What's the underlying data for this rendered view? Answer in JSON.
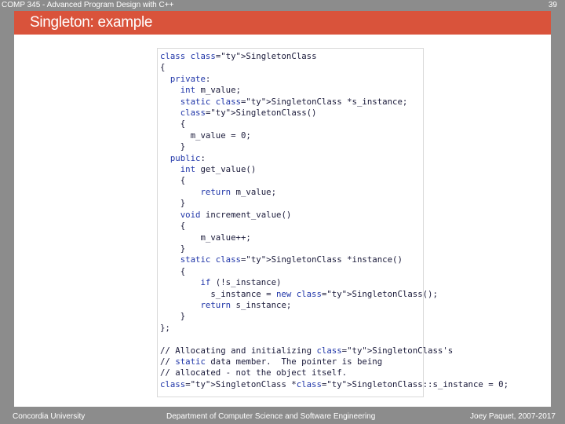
{
  "header": {
    "course": "COMP 345 - Advanced Program Design with C++",
    "page_number": "39"
  },
  "slide": {
    "title": "Singleton: example"
  },
  "code_lines": [
    "class SingletonClass",
    "{",
    "  private:",
    "    int m_value;",
    "    static SingletonClass *s_instance;",
    "    SingletonClass()",
    "    {",
    "      m_value = 0;",
    "    }",
    "  public:",
    "    int get_value()",
    "    {",
    "        return m_value;",
    "    }",
    "    void increment_value()",
    "    {",
    "        m_value++;",
    "    }",
    "    static SingletonClass *instance()",
    "    {",
    "        if (!s_instance)",
    "          s_instance = new SingletonClass();",
    "        return s_instance;",
    "    }",
    "};",
    "",
    "// Allocating and initializing SingletonClass's",
    "// static data member.  The pointer is being",
    "// allocated - not the object itself.",
    "SingletonClass *SingletonClass::s_instance = 0;"
  ],
  "footer": {
    "left": "Concordia University",
    "center": "Department of Computer Science and Software Engineering",
    "right": "Joey Paquet, 2007-2017"
  },
  "colors": {
    "title_bar": "#d9533b",
    "frame": "#8c8c8c",
    "keyword": "#1f35a8",
    "type_name": "#2a7a8c"
  }
}
